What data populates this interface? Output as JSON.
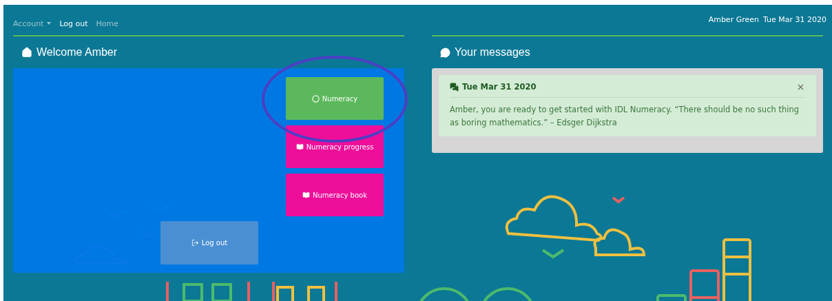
{
  "navbar": {
    "items": [
      {
        "label": "Account",
        "kind": "dropdown",
        "selected": false
      },
      {
        "label": "Log out",
        "kind": "link",
        "selected": true
      },
      {
        "label": "Home",
        "kind": "link",
        "selected": false
      }
    ],
    "user": "Amber Green",
    "date": "Tue Mar 31 2020"
  },
  "welcome": {
    "title": "Welcome Amber",
    "buttons": [
      {
        "label": "Numeracy",
        "kind": "start"
      },
      {
        "label": "Numeracy progress",
        "kind": "book"
      },
      {
        "label": "Numeracy book",
        "kind": "book"
      }
    ],
    "logout": "Log out"
  },
  "messages": {
    "title": "Your messages",
    "items": [
      {
        "date": "Tue Mar 31 2020",
        "text": "Amber, you are ready to get started with IDL Numeracy. “There should be no such thing as boring mathematics.” – Edsger Dijkstra"
      }
    ]
  }
}
